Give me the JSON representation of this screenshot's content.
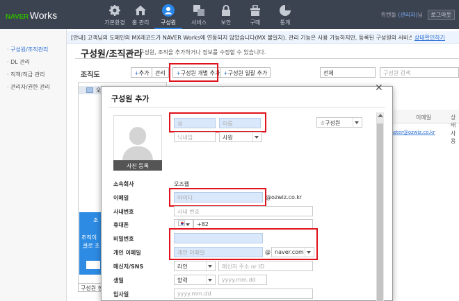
{
  "app": {
    "logo_naver": "NAVER",
    "logo_works": "Works"
  },
  "nav": [
    {
      "label": "기본환경",
      "icon": "gear-icon"
    },
    {
      "label": "홈 관리",
      "icon": "home-icon"
    },
    {
      "label": "구성원",
      "icon": "person-icon",
      "active": true
    },
    {
      "label": "서비스",
      "icon": "squares-icon"
    },
    {
      "label": "보안",
      "icon": "lock-icon"
    },
    {
      "label": "구매",
      "icon": "cart-icon"
    },
    {
      "label": "통계",
      "icon": "piechart-icon"
    }
  ],
  "header": {
    "user_prefix": "위캔돌",
    "admin_label": "(관리자)",
    "user_suffix": "님",
    "logout": "로그아웃"
  },
  "notice": {
    "text": "[안내] 고객님의 도메인의 MX레코드가 NAVER Works에 연동되지 않았습니다(MX 불일치). 관리 기능은 사용 가능하지만, 등록된 구성원의 서비스 이용은 ...",
    "link": "상태확인하기"
  },
  "sidebar": {
    "items": [
      {
        "label": "· 구성원/조직관리",
        "active": true
      },
      {
        "label": "· DL 관리"
      },
      {
        "label": "· 직책/직급 관리"
      },
      {
        "label": "· 관리자/권한 관리"
      }
    ]
  },
  "page": {
    "title": "구성원/조직관리",
    "description": "구성원, 조직을 추가하거나 정보를 수정할 수 있습니다."
  },
  "org": {
    "title": "조직도",
    "add": "추가",
    "manage": "관리",
    "add_member_single": "구성원 개별 추가",
    "add_member_bulk": "구성원 일괄 추가",
    "filter_value": "전체",
    "search_placeholder": "구성원 검색",
    "tree_first_initial": "오",
    "bottom_button": "구성원 정"
  },
  "grid": {
    "col_email": "이메일",
    "col_status": "상태",
    "row_email": "aster@ozwiz.co.kr",
    "row_status": "사용"
  },
  "left_panel": {
    "title": "조",
    "line1": "조직이",
    "line2": "클로 조"
  },
  "modal": {
    "title": "구성원 추가",
    "photo_button": "사진 등록",
    "type_select": "구성원",
    "fields": {
      "surname_placeholder": "성",
      "name_placeholder": "이름",
      "nickname_placeholder": "닉네임",
      "rank_select": "사원",
      "company_label": "소속회사",
      "company_value": "오즈웹",
      "email_label": "이메일",
      "email_id_placeholder": "아이디",
      "email_domain": "@ozwiz.co.kr",
      "employee_no_label": "사내번호",
      "employee_no_placeholder": "사내 번호",
      "phone_label": "휴대폰",
      "phone_code": "+82",
      "password_label": "비밀번호",
      "personal_email_label": "개인 이메일",
      "personal_email_placeholder": "개인 이메일",
      "at_sign": "@",
      "personal_email_domain": "naver.com",
      "messenger_label": "메신저/SNS",
      "messenger_select": "라인",
      "messenger_placeholder": "메신저 주소 or ID",
      "birthday_label": "생일",
      "calendar_select": "양력",
      "birthday_placeholder": "yyyy.mm.dd",
      "join_label": "입사일",
      "join_placeholder": "yyyy.mm.dd"
    }
  },
  "colors": {
    "header_bg": "#3b4250",
    "accent_blue": "#2a86e8",
    "highlight_red": "#e0121b",
    "logo_green": "#2db400"
  }
}
